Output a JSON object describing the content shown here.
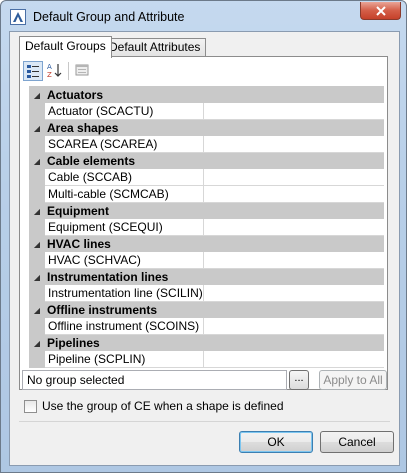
{
  "window": {
    "title": "Default Group and Attribute"
  },
  "tabs": [
    {
      "label": "Default Groups",
      "active": true
    },
    {
      "label": "Default Attributes",
      "active": false
    }
  ],
  "toolbar": {
    "categorized_icon": "categorized-view-icon",
    "alphabetical_icon": "sort-alphabetical-icon",
    "property_pages_icon": "property-pages-icon"
  },
  "groups": [
    {
      "category": "Actuators",
      "item": "Actuator (SCACTU)",
      "value": ""
    },
    {
      "category": "Area shapes",
      "item": "SCAREA (SCAREA)",
      "value": ""
    },
    {
      "category": "Cable elements",
      "items": [
        "Cable (SCCAB)",
        "Multi-cable (SCMCAB)"
      ]
    },
    {
      "category": "Equipment",
      "item": "Equipment (SCEQUI)",
      "value": ""
    },
    {
      "category": "HVAC lines",
      "item": "HVAC (SCHVAC)",
      "value": ""
    },
    {
      "category": "Instrumentation lines",
      "item": "Instrumentation line (SCILIN)",
      "value": ""
    },
    {
      "category": "Offline instruments",
      "item": "Offline instrument (SCOINS)",
      "value": ""
    },
    {
      "category": "Pipelines",
      "item": "Pipeline (SCPLIN)",
      "value": ""
    }
  ],
  "status": {
    "value": "No group selected",
    "browse_label": "...",
    "apply_label": "Apply to All"
  },
  "checkbox": {
    "label": "Use the group of CE when a shape is defined",
    "checked": false
  },
  "buttons": {
    "ok_label": "OK",
    "cancel_label": "Cancel"
  },
  "colors": {
    "category_bg": "#c9c9c9",
    "title_gradient": "#b8cfe8",
    "close_button": "#c5412a"
  }
}
